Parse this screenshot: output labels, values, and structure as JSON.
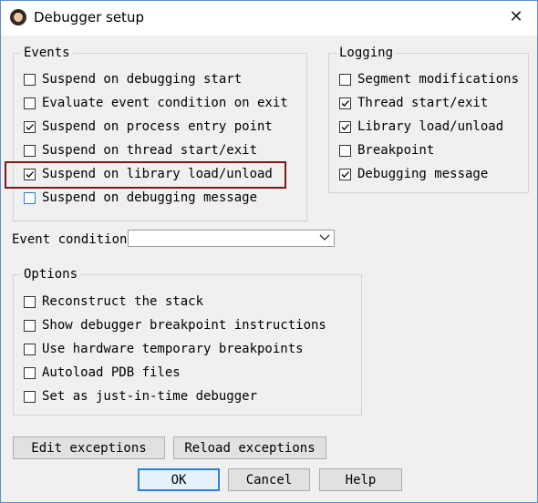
{
  "window": {
    "title": "Debugger setup",
    "close_glyph": "✕",
    "icon": "app-portrait-icon"
  },
  "events": {
    "legend": "Events",
    "items": [
      {
        "label": "Suspend on debugging start",
        "checked": false
      },
      {
        "label": "Evaluate event condition on exit",
        "checked": false
      },
      {
        "label": "Suspend on process entry point",
        "checked": true
      },
      {
        "label": "Suspend on thread start/exit",
        "checked": false
      },
      {
        "label": "Suspend on library load/unload",
        "checked": true
      },
      {
        "label": "Suspend on debugging message",
        "checked": false
      }
    ]
  },
  "logging": {
    "legend": "Logging",
    "items": [
      {
        "label": "Segment modifications",
        "checked": false
      },
      {
        "label": "Thread start/exit",
        "checked": true
      },
      {
        "label": "Library load/unload",
        "checked": true
      },
      {
        "label": "Breakpoint",
        "checked": false
      },
      {
        "label": "Debugging message",
        "checked": true
      }
    ]
  },
  "event_condition": {
    "label": "Event condition",
    "value": ""
  },
  "options": {
    "legend": "Options",
    "items": [
      {
        "label": "Reconstruct the stack",
        "checked": false
      },
      {
        "label": "Show debugger breakpoint instructions",
        "checked": false
      },
      {
        "label": "Use hardware temporary breakpoints",
        "checked": false
      },
      {
        "label": "Autoload PDB files",
        "checked": false
      },
      {
        "label": "Set as just-in-time debugger",
        "checked": false
      }
    ]
  },
  "buttons": {
    "edit_exceptions": "Edit exceptions",
    "reload_exceptions": "Reload exceptions",
    "ok": "OK",
    "cancel": "Cancel",
    "help": "Help"
  },
  "colors": {
    "highlight_box": "#7b1a1a",
    "focus_blue": "#2a7fd6"
  }
}
